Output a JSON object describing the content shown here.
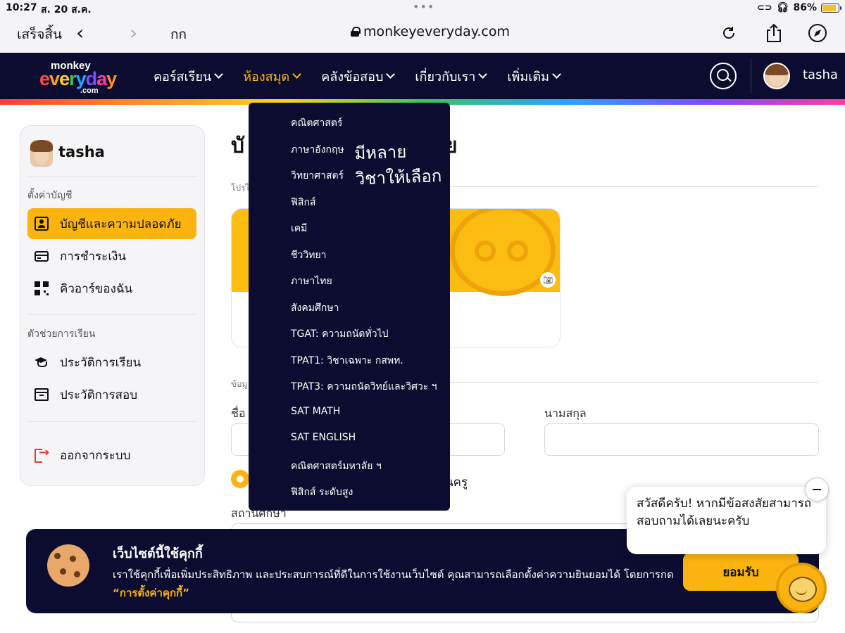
{
  "status_bar": {
    "time": "10:27",
    "date": "ส. 20 ส.ค.",
    "battery": "86%",
    "battery_level": 0.86
  },
  "safari": {
    "done": "เสร็จสิ้น",
    "reader": "กก",
    "url": "monkeyeveryday.com"
  },
  "header": {
    "logo_top": "monkey",
    "logo_main": "everyday",
    "logo_suffix": ".com",
    "nav": [
      {
        "label": "คอร์สเรียน",
        "active": false
      },
      {
        "label": "ห้องสมุด",
        "active": true
      },
      {
        "label": "คลังข้อสอบ",
        "active": false
      },
      {
        "label": "เกี่ยวกับเรา",
        "active": false
      },
      {
        "label": "เพิ่มเติม",
        "active": false
      }
    ],
    "username": "tasha"
  },
  "sidebar": {
    "username": "tasha",
    "section_account": "ตั้งค่าบัญชี",
    "section_learning": "ตัวช่วยการเรียน",
    "items": [
      {
        "label": "บัญชีและความปลอดภัย",
        "active": true
      },
      {
        "label": "การชำระเงิน",
        "active": false
      },
      {
        "label": "คิวอาร์ของฉัน",
        "active": false
      },
      {
        "label": "ประวัติการเรียน",
        "active": false
      },
      {
        "label": "ประวัติการสอบ",
        "active": false
      }
    ],
    "logout": "ออกจากระบบ"
  },
  "main": {
    "title_visible": "บั",
    "title_tail": "ย",
    "hint": "โปรไ",
    "section2_hint": "ข้อมู",
    "first_name_label": "ชื่อ",
    "last_name_label": "นามสกุล",
    "role_label": "นครู",
    "school_label": "สถานศึกษา"
  },
  "dropdown": {
    "items": [
      "คณิตศาสตร์",
      "ภาษาอังกฤษ",
      "วิทยาศาสตร์",
      "ฟิสิกส์",
      "เคมี",
      "ชีววิทยา",
      "ภาษาไทย",
      "สังคมศึกษา",
      "TGAT: ความถนัดทั่วไป",
      "TPAT1: วิชาเฉพาะ กสพท.",
      "TPAT3: ความถนัดวิทย์และวิศวะ ฯ",
      "SAT MATH",
      "SAT ENGLISH",
      "คณิตศาสตร์มหาลัย ฯ",
      "ฟิสิกส์ ระดับสูง"
    ],
    "handwritten_note_line1": "มีหลาย",
    "handwritten_note_line2": "วิชาให้เลือก"
  },
  "cookie": {
    "title": "เว็บไซต์นี้ใช้คุกกี้",
    "text": "เราใช้คุกกี้เพื่อเพิ่มประสิทธิภาพ และประสบการณ์ที่ดีในการใช้งานเว็บไซต์ คุณสามารถเลือกตั้งค่าความยินยอมได้ โดยการกด",
    "link": "“การตั้งค่าคุกกี้”",
    "accept": "ยอมรับ"
  },
  "chat": {
    "message": "สวัสดีครับ! หากมีข้อสงสัยสามารถสอบถามได้เลยนะครับ"
  },
  "colors": {
    "navy": "#0c0c30",
    "accent": "#fbb40f",
    "logout_red": "#e53935"
  }
}
